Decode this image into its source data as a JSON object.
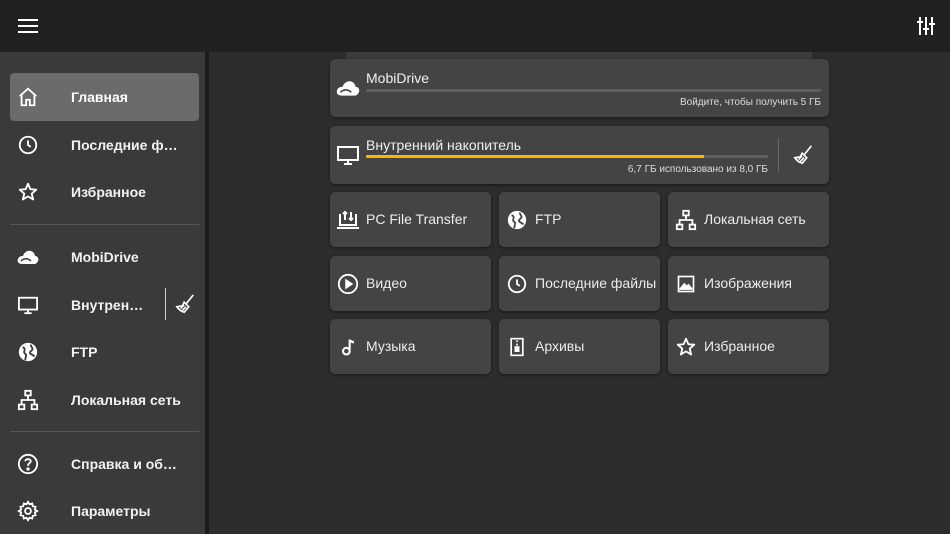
{
  "colors": {
    "topbar": "#212121",
    "background": "#2d2d2d",
    "sidebar": "#3a3a3a",
    "card": "#444444",
    "accent": "#f5b800"
  },
  "topbar": {
    "menu_icon": "hamburger-menu-icon",
    "filter_icon": "equalizer-icon"
  },
  "sidebar": {
    "items": [
      {
        "label": "Главная",
        "icon": "home-icon",
        "active": true
      },
      {
        "label": "Последние файлы",
        "icon": "clock-icon"
      },
      {
        "label": "Избранное",
        "icon": "star-icon"
      },
      {
        "label": "MobiDrive",
        "icon": "cloud-icon"
      },
      {
        "label": "Внутренний накопитель",
        "icon": "monitor-icon"
      },
      {
        "label": "FTP",
        "icon": "globe-icon"
      },
      {
        "label": "Локальная сеть",
        "icon": "network-icon"
      },
      {
        "label": "Справка и обратная связь",
        "icon": "help-icon"
      },
      {
        "label": "Параметры",
        "icon": "settings-icon"
      }
    ],
    "clean_icon": "broom-icon"
  },
  "storage": {
    "mobidrive": {
      "title": "MobiDrive",
      "subtitle": "Войдите, чтобы получить 5 ГБ",
      "progress": 0
    },
    "internal": {
      "title": "Внутренний накопитель",
      "subtitle": "6,7 ГБ использовано из 8,0 ГБ",
      "progress": 0.84
    }
  },
  "tiles": [
    {
      "label": "PC File Transfer",
      "icon": "pc-transfer-icon"
    },
    {
      "label": "FTP",
      "icon": "globe-icon"
    },
    {
      "label": "Локальная сеть",
      "icon": "network-icon"
    },
    {
      "label": "Видео",
      "icon": "play-icon"
    },
    {
      "label": "Последние файлы",
      "icon": "clock-icon"
    },
    {
      "label": "Изображения",
      "icon": "image-icon"
    },
    {
      "label": "Музыка",
      "icon": "music-note-icon"
    },
    {
      "label": "Архивы",
      "icon": "archive-icon"
    },
    {
      "label": "Избранное",
      "icon": "star-icon"
    }
  ]
}
